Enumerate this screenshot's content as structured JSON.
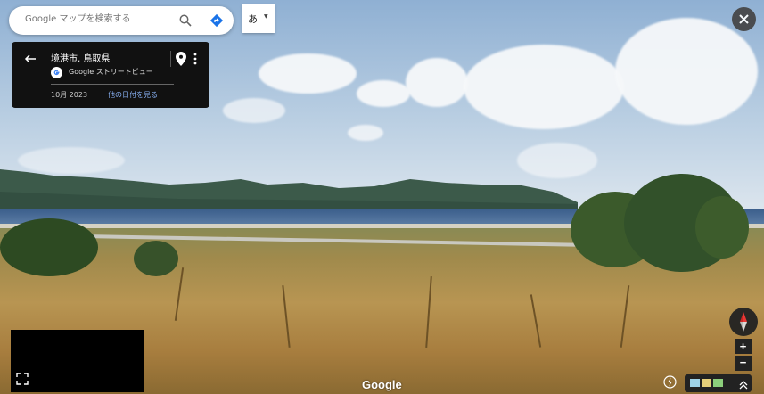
{
  "search": {
    "placeholder": "Google マップを検索する"
  },
  "ime": {
    "label": "あ"
  },
  "info_card": {
    "title": "境港市, 鳥取県",
    "service_label": "Google ストリートビュー",
    "date": "10月 2023",
    "other_dates_link": "他の日付を見る"
  },
  "watermark": "Google",
  "zoom": {
    "in_label": "+",
    "out_label": "−"
  },
  "colors": {
    "card_bg": "#111111",
    "link": "#8ab4f8",
    "accent": "#1a73e8"
  },
  "icons": [
    "search-icon",
    "directions-icon",
    "close-icon",
    "back-arrow-icon",
    "google-g-icon",
    "location-pin-icon",
    "more-vert-icon",
    "expand-icon",
    "compass-icon",
    "flash-icon",
    "chevron-up-icon"
  ]
}
